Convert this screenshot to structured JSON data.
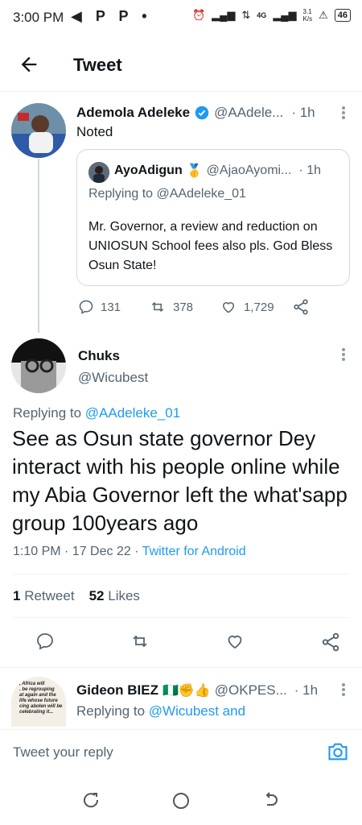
{
  "status_bar": {
    "time": "3:00 PM",
    "left_icons": "◀ P P •",
    "network": "4G",
    "speed": "3.1\nK/s",
    "battery": "46"
  },
  "header": {
    "title": "Tweet"
  },
  "parent_tweet": {
    "name": "Ademola Adeleke",
    "handle": "@AAdele...",
    "time": "· 1h",
    "text": "Noted",
    "replies": "131",
    "retweets": "378",
    "likes": "1,729",
    "quoted": {
      "name": "AyoAdigun",
      "badge": "🥇",
      "handle": "@AjaoAyomi...",
      "time": "· 1h",
      "replying_prefix": "Replying to",
      "replying_to": "@AAdeleke_01",
      "text": "Mr. Governor, a review and reduction on UNIOSUN School fees also pls. God Bless Osun State!"
    }
  },
  "main_tweet": {
    "name": "Chuks",
    "handle": "@Wicubest",
    "replying_prefix": "Replying to",
    "replying_to": "@AAdeleke_01",
    "text": "See as Osun state governor Dey interact with his people online while my Abia Governor left the what'sapp group 100years ago",
    "timestamp": "1:10 PM · 17 Dec 22 ·",
    "source": "Twitter for Android",
    "retweets_count": "1",
    "retweets_label": "Retweet",
    "likes_count": "52",
    "likes_label": "Likes"
  },
  "reply_tweet": {
    "name": "Gideon BIEZ",
    "emoji": "🇳🇬✊👍",
    "handle": "@OKPES...",
    "time": "· 1h",
    "replying_prefix": "Replying to",
    "replying_to": "@Wicubest and",
    "avatar_text": ", Africa will\n. be regrouping\nat again and the\nlife whose future\ncing abolen will be\ncelebrating it..."
  },
  "reply_bar": {
    "placeholder": "Tweet your reply"
  },
  "colors": {
    "accent": "#1d9bf0",
    "muted": "#536471",
    "verified": "#1d9bf0"
  }
}
